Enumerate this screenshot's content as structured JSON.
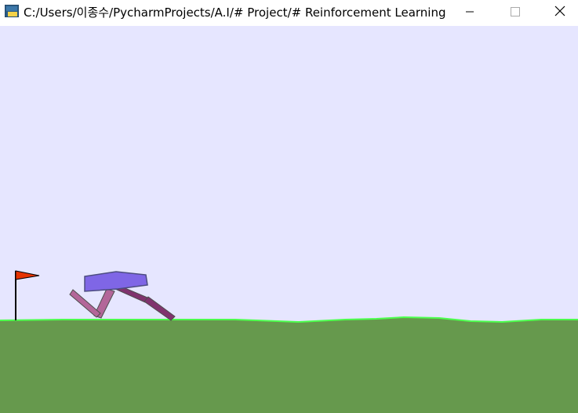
{
  "window": {
    "title": "C:/Users/이종수/PycharmProjects/A.I/# Project/# Reinforcement Learning - U...",
    "app_icon": "python-icon",
    "controls": {
      "minimize_icon": "minimize-icon",
      "maximize_icon": "maximize-icon",
      "close_icon": "close-icon"
    }
  },
  "scene": {
    "environment": "BipedalWalker",
    "colors": {
      "sky": "#e6e6ff",
      "ground": "#66994d",
      "ground_edge": "#4dff4d",
      "hull": "#7f66e6",
      "hull_outline": "#4d4d80",
      "leg_near": "#b36699",
      "leg_far": "#80336e",
      "flag": "#e63300",
      "flagpole": "#000000"
    }
  }
}
